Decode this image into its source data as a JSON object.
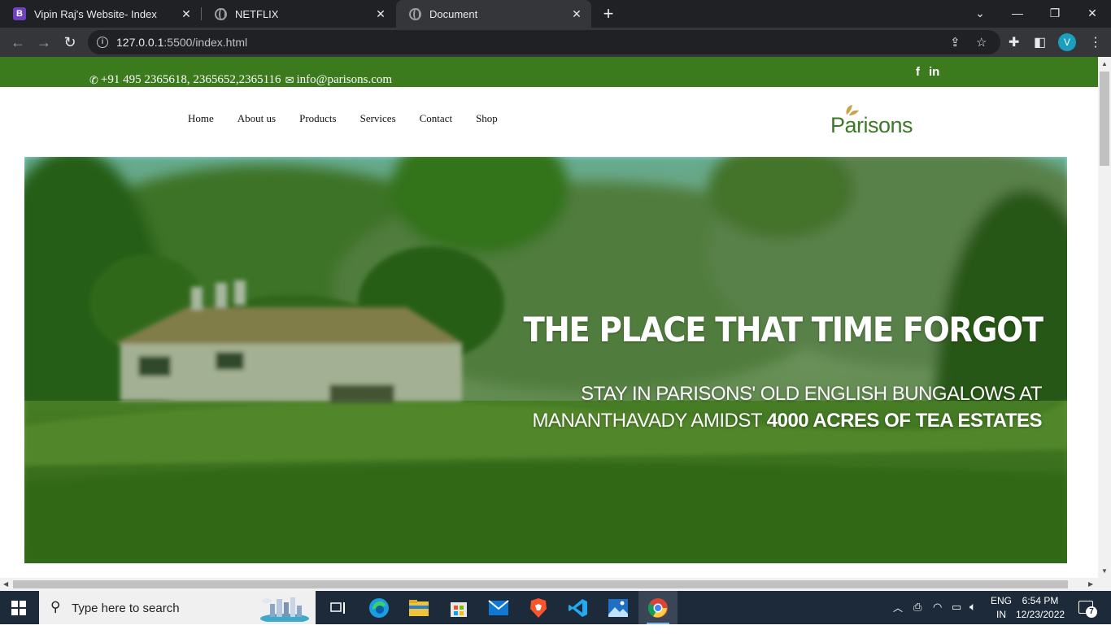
{
  "browser": {
    "tabs": [
      {
        "title": "Vipin Raj's Website- Index",
        "favicon": "bootstrap-b-icon",
        "active": false
      },
      {
        "title": "NETFLIX",
        "favicon": "globe-icon",
        "active": false
      },
      {
        "title": "Document",
        "favicon": "globe-icon",
        "active": true
      }
    ],
    "new_tab_label": "+",
    "url_host": "127.0.0.1",
    "url_path": ":5500/index.html",
    "profile_initial": "V"
  },
  "page": {
    "topbar": {
      "phone": "+91 495 2365618, 2365652,2365116",
      "email": "info@parisons.com",
      "social": [
        "f",
        "in"
      ],
      "color": "#3c7a1e"
    },
    "nav": {
      "links": [
        "Home",
        "About us",
        "Products",
        "Services",
        "Contact",
        "Shop"
      ]
    },
    "logo": {
      "text": "Parisons",
      "color": "#3b7a26"
    },
    "hero": {
      "headline": "THE PLACE THAT TIME FORGOT",
      "sub_line1": "STAY IN PARISONS' OLD ENGLISH BUNGALOWS AT",
      "sub_line2_prefix": "MANANTHAVADY AMIDST ",
      "sub_line2_bold": "4000 ACRES OF TEA ESTATES"
    }
  },
  "taskbar": {
    "search_placeholder": "Type here to search",
    "apps": [
      "task-view-icon",
      "edge-icon",
      "file-explorer-icon",
      "store-icon",
      "mail-icon",
      "brave-icon",
      "vscode-icon",
      "photos-icon",
      "chrome-icon"
    ],
    "lang_top": "ENG",
    "lang_bottom": "IN",
    "time": "6:54 PM",
    "date": "12/23/2022",
    "notification_count": "7"
  }
}
